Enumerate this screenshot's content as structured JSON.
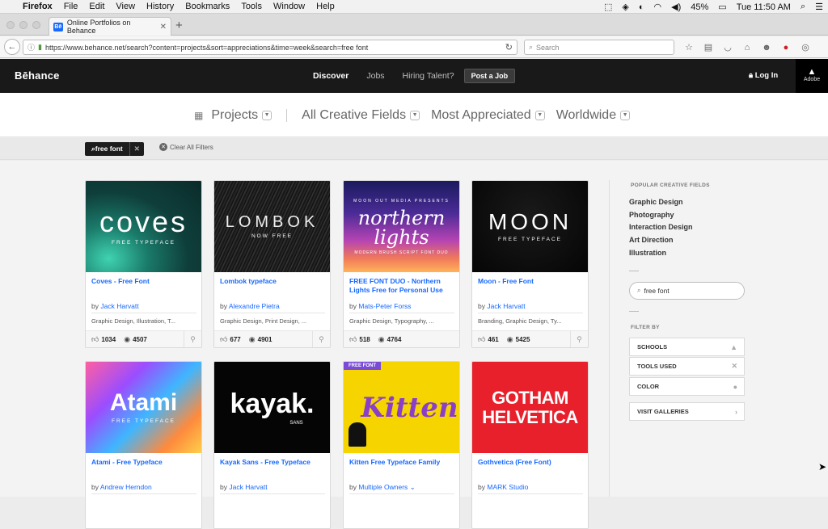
{
  "menubar": {
    "apple": "",
    "app": "Firefox",
    "items": [
      "File",
      "Edit",
      "View",
      "History",
      "Bookmarks",
      "Tools",
      "Window",
      "Help"
    ],
    "battery": "45%",
    "clock": "Tue 11:50 AM"
  },
  "tab": {
    "favicon": "Bē",
    "title": "Online Portfolios on Behance",
    "new_tab": "+"
  },
  "nav": {
    "url": "https://www.behance.net/search?content=projects&sort=appreciations&time=week&search=free font",
    "search_placeholder": "Search"
  },
  "header": {
    "logo": "Bēhance",
    "nav": [
      "Discover",
      "Jobs",
      "Hiring Talent?"
    ],
    "post_job": "Post a Job",
    "login": "Log In",
    "adobe": "Adobe"
  },
  "filters": {
    "projects": "Projects",
    "fields": "All Creative Fields",
    "sort": "Most Appreciated",
    "location": "Worldwide"
  },
  "active": {
    "tag": "free font",
    "clear": "Clear All Filters"
  },
  "cards": [
    {
      "cover_big": "coves",
      "cover_small": "FREE TYPEFACE",
      "title": "Coves - Free Font",
      "by": "by",
      "owner": "Jack Harvatt",
      "fields": "Graphic Design, Illustration, T...",
      "likes": "1034",
      "views": "4507"
    },
    {
      "cover_big": "LOMBOK",
      "cover_small": "NOW FREE",
      "title": "Lombok typeface",
      "by": "by",
      "owner": "Alexandre Pietra",
      "fields": "Graphic Design, Print Design, ...",
      "likes": "677",
      "views": "4901"
    },
    {
      "cover_top": "MOON OUT MEDIA PRESENTS",
      "cover_big": "northern lights",
      "cover_small": "MODERN BRUSH SCRIPT FONT DUO",
      "title": "FREE FONT DUO - Northern Lights Free for Personal Use",
      "by": "by",
      "owner": "Mats-Peter Forss",
      "fields": "Graphic Design, Typography, ...",
      "likes": "518",
      "views": "4764"
    },
    {
      "cover_big": "MOON",
      "cover_small": "FREE TYPEFACE",
      "title": "Moon - Free Font",
      "by": "by",
      "owner": "Jack Harvatt",
      "fields": "Branding, Graphic Design, Ty...",
      "likes": "461",
      "views": "5425"
    },
    {
      "cover_big": "Atami",
      "cover_small": "FREE TYPEFACE",
      "title": "Atami - Free Typeface",
      "by": "by",
      "owner": "Andrew Herndon"
    },
    {
      "cover_big": "kayak.",
      "cover_small": "SANS",
      "title": "Kayak Sans - Free Typeface",
      "by": "by",
      "owner": "Jack Harvatt"
    },
    {
      "badge": "FREE FONT",
      "cover_big": "Kitten",
      "title": "Kitten Free Typeface Family",
      "by": "by",
      "owner": "Multiple Owners ⌄"
    },
    {
      "cover_big1": "GOTHAM",
      "cover_big2": "HELVETICA",
      "title": "Gothvetica (Free Font)",
      "by": "by",
      "owner": "MARK Studio"
    }
  ],
  "sidebar": {
    "popular_head": "POPULAR CREATIVE FIELDS",
    "fields": [
      "Graphic Design",
      "Photography",
      "Interaction Design",
      "Art Direction",
      "Illustration"
    ],
    "search_value": "free font",
    "filter_head": "FILTER BY",
    "filters": [
      "SCHOOLS",
      "TOOLS USED",
      "COLOR"
    ],
    "galleries": "VISIT GALLERIES"
  },
  "colors": {
    "link": "#1769ff",
    "header_bg": "#191919"
  }
}
